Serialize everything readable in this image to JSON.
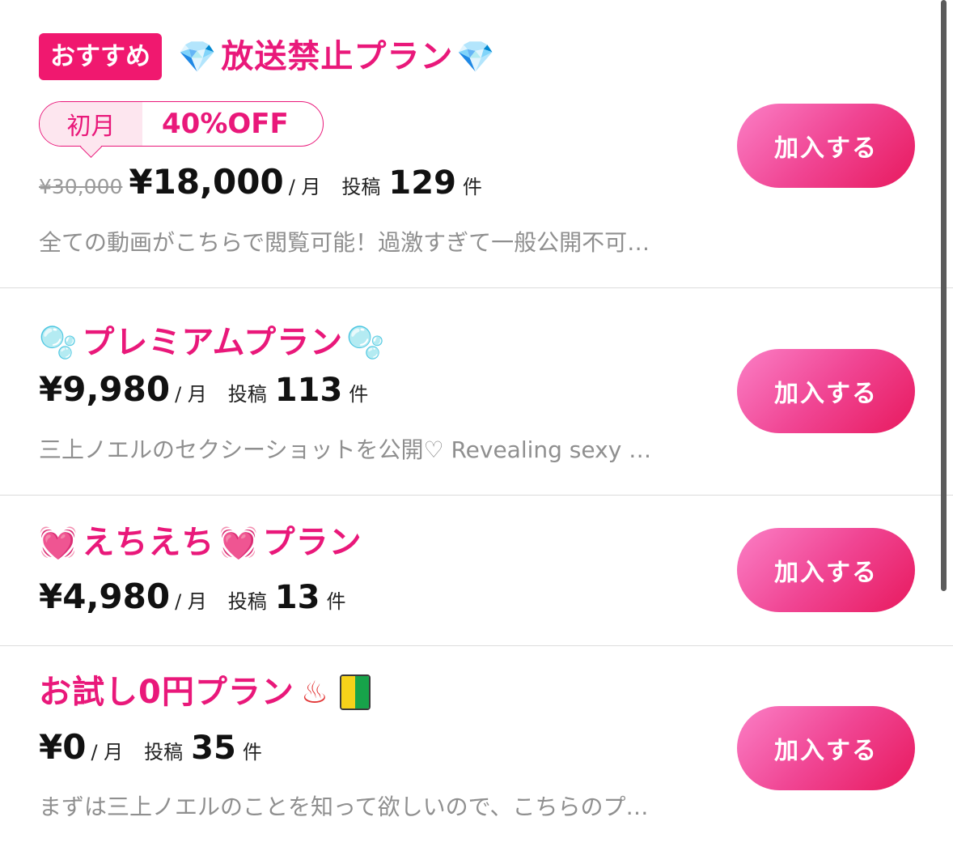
{
  "colors": {
    "accent": "#e9187a",
    "button_gradient_start": "#fb7fc6",
    "button_gradient_end": "#e8195e",
    "muted_text": "#8f8f8f"
  },
  "plans": [
    {
      "recommended_badge": "おすすめ",
      "title": "放送禁止プラン",
      "title_icons": [
        "gem-icon",
        "gem-icon"
      ],
      "discount": {
        "month_label": "初月",
        "off_label": "40%OFF"
      },
      "old_price": "¥30,000",
      "price": "¥18,000",
      "per_unit": "/ 月",
      "posts_label": "投稿",
      "posts_count": "129",
      "posts_unit": "件",
      "description": "全ての動画がこちらで閲覧可能！過激すぎて一般公開不可…",
      "join_label": "加入する"
    },
    {
      "title": "プレミアムプラン",
      "title_icons": [
        "bubbles-icon",
        "bubbles-icon"
      ],
      "price": "¥9,980",
      "per_unit": "/ 月",
      "posts_label": "投稿",
      "posts_count": "113",
      "posts_unit": "件",
      "description": "三上ノエルのセクシーショットを公開♡ Revealing sexy …",
      "join_label": "加入する"
    },
    {
      "title_part1": "えちえち",
      "title_part2": "プラン",
      "title_icons": [
        "vibrating-heart-icon",
        "vibrating-heart-icon"
      ],
      "price": "¥4,980",
      "per_unit": "/ 月",
      "posts_label": "投稿",
      "posts_count": "13",
      "posts_unit": "件",
      "join_label": "加入する"
    },
    {
      "title": "お試し0円プラン",
      "title_icons": [
        "hot-springs-icon",
        "beginner-mark-icon"
      ],
      "price": "¥0",
      "per_unit": "/ 月",
      "posts_label": "投稿",
      "posts_count": "35",
      "posts_unit": "件",
      "description": "まずは三上ノエルのことを知って欲しいので、こちらのプ…",
      "join_label": "加入する"
    }
  ]
}
